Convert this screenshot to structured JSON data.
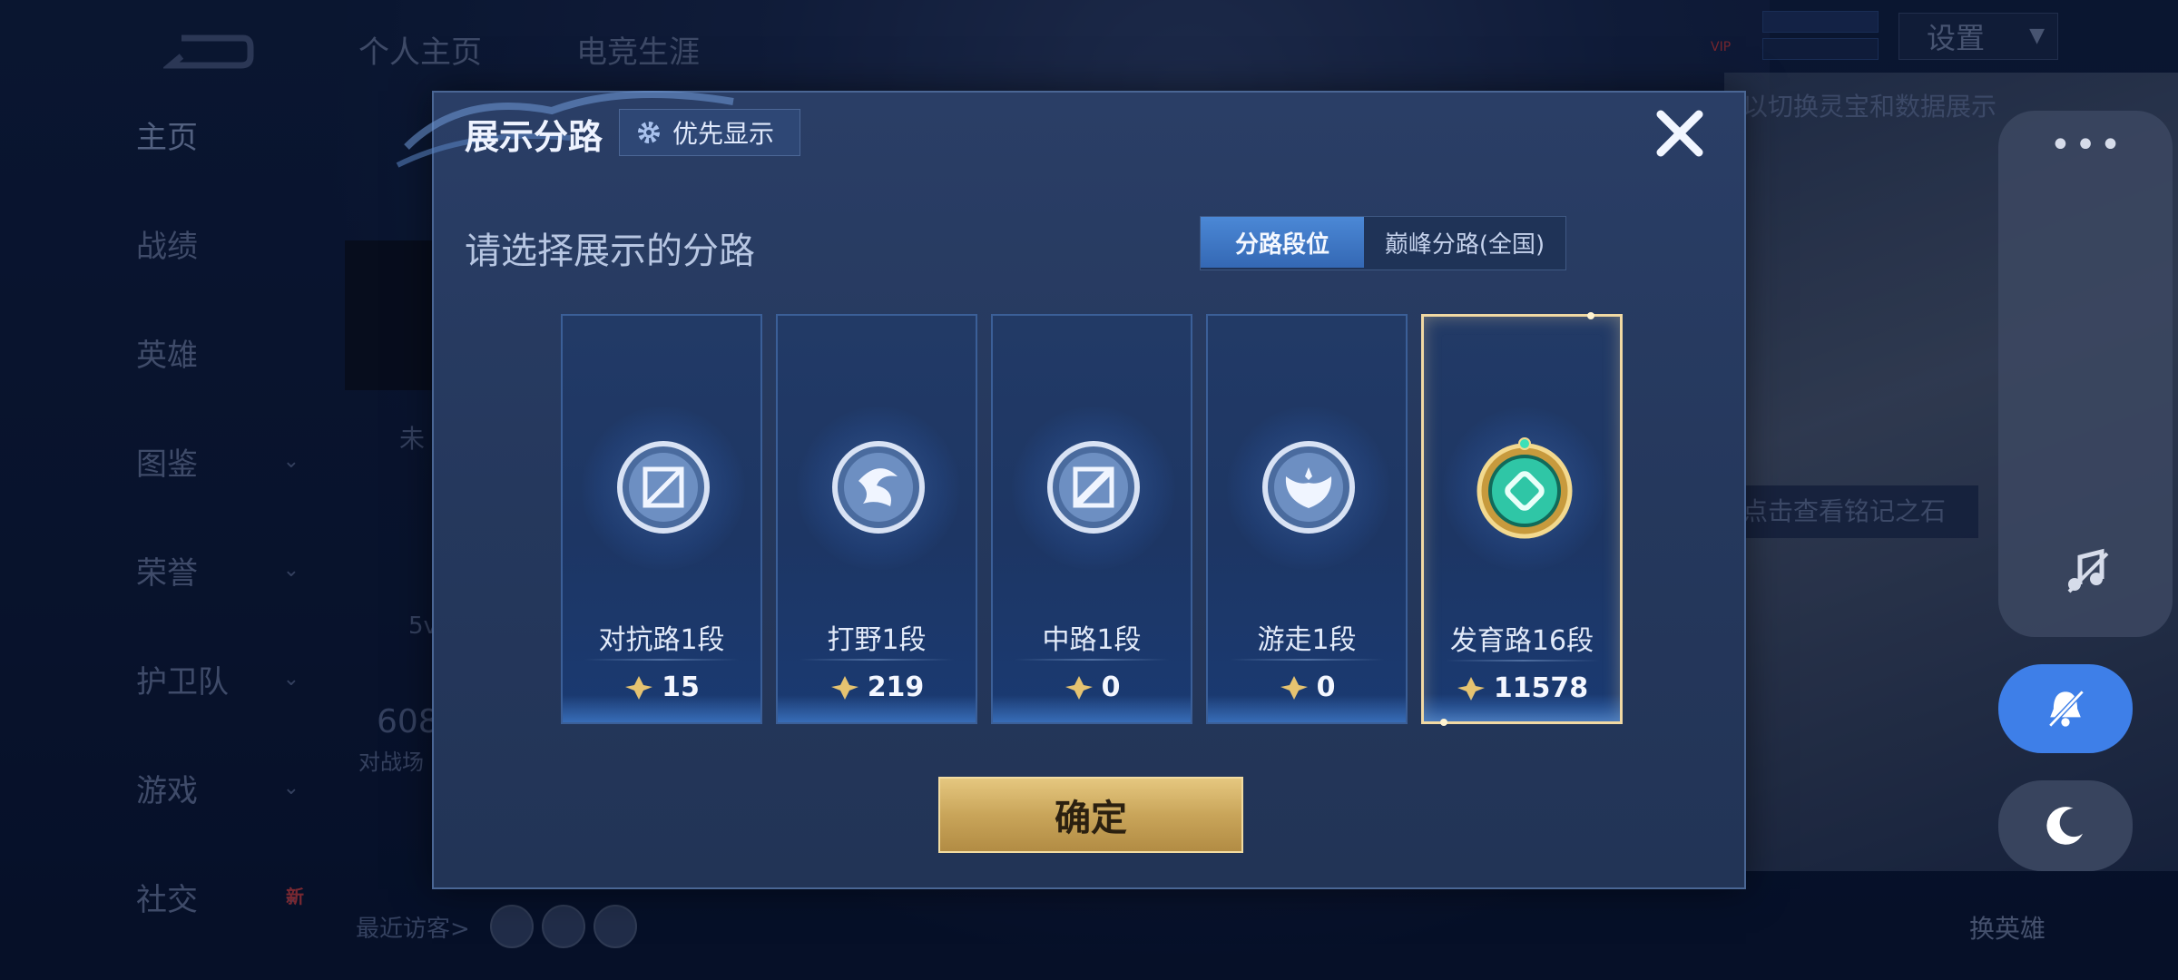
{
  "background": {
    "top_tabs": [
      "个人主页",
      "电竞生涯"
    ],
    "settings_label": "设置",
    "vip_label": "VIP",
    "hint_top": "以切换灵宝和数据展示",
    "hint_mid": "点击查看铭记之石",
    "sidebar": [
      {
        "label": "主页",
        "chevron": false
      },
      {
        "label": "战绩",
        "chevron": false
      },
      {
        "label": "英雄",
        "chevron": false
      },
      {
        "label": "图鉴",
        "chevron": true
      },
      {
        "label": "荣誉",
        "chevron": true
      },
      {
        "label": "护卫队",
        "chevron": true
      },
      {
        "label": "游戏",
        "chevron": true
      },
      {
        "label": "社交",
        "chevron": true
      }
    ],
    "new_badge": "新",
    "recent_visitors": "最近访客>",
    "left_number": "608",
    "left_small": "对战场",
    "left_five": "5v",
    "left_status": "未",
    "swap_hero": "换英雄"
  },
  "modal": {
    "title": "展示分路",
    "priority_button": "优先显示",
    "subtitle": "请选择展示的分路",
    "segment": [
      "分路段位",
      "巅峰分路(全国)"
    ],
    "active_segment": 0,
    "lanes": [
      {
        "name": "对抗路1段",
        "score": "15",
        "icon": "sword-shield-emblem-icon",
        "selected": false
      },
      {
        "name": "打野1段",
        "score": "219",
        "icon": "dragon-emblem-icon",
        "selected": false
      },
      {
        "name": "中路1段",
        "score": "0",
        "icon": "staff-emblem-icon",
        "selected": false
      },
      {
        "name": "游走1段",
        "score": "0",
        "icon": "wings-emblem-icon",
        "selected": false
      },
      {
        "name": "发育路16段",
        "score": "11578",
        "icon": "gold-jade-emblem-icon",
        "selected": true
      }
    ],
    "confirm": "确定"
  },
  "colors": {
    "modal_bg": "#25385d",
    "accent_blue": "#3e7fe8",
    "gold": "#e5c77f",
    "selected_border": "#f1d9a3"
  }
}
